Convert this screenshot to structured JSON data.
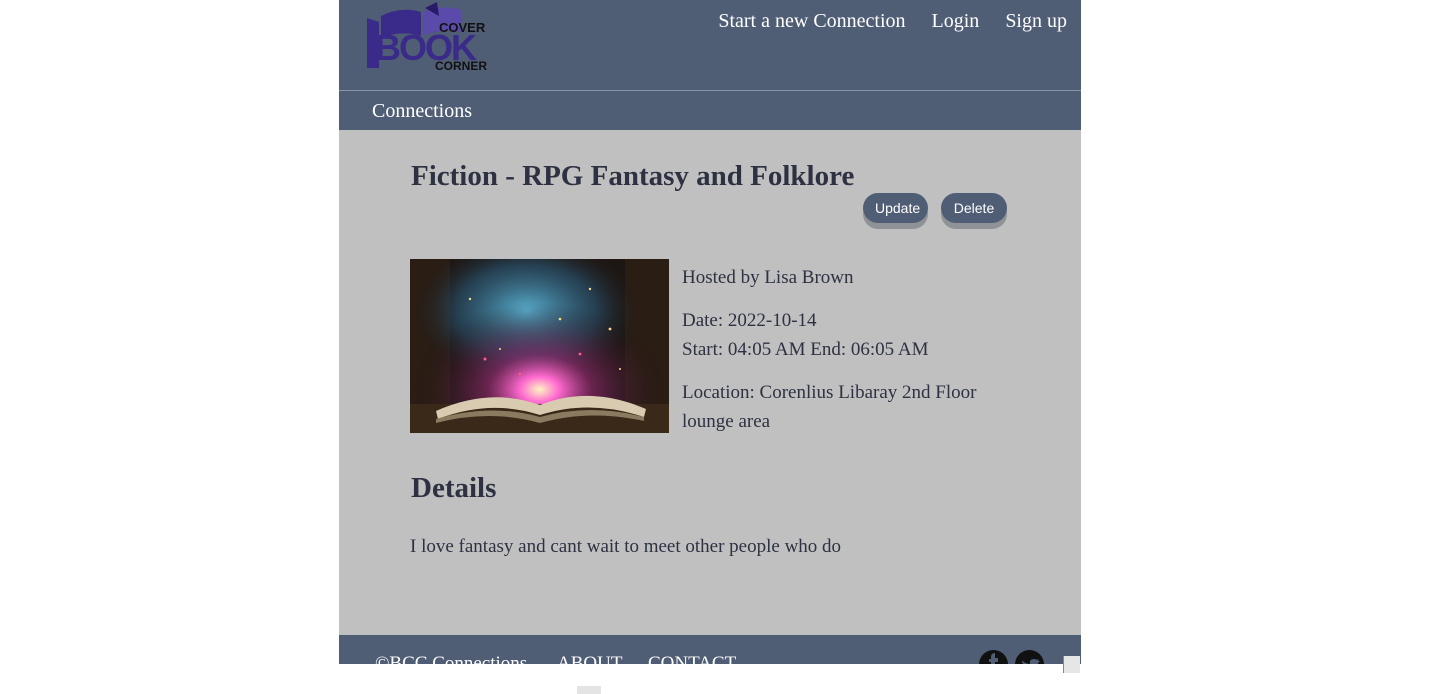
{
  "header": {
    "logo_text": {
      "top": "COVER",
      "main": "BOOK",
      "bottom": "CORNER"
    },
    "nav": [
      {
        "label": "Start a new Connection"
      },
      {
        "label": "Login"
      },
      {
        "label": "Sign up"
      }
    ]
  },
  "subnav": {
    "label": "Connections"
  },
  "connection": {
    "title": "Fiction - RPG Fantasy and Folklore",
    "update_label": "Update",
    "delete_label": "Delete",
    "host": "Hosted by Lisa Brown",
    "date": "Date: 2022-10-14",
    "time": "Start: 04:05 AM End: 06:05 AM",
    "location": "Location: Corenlius Libaray 2nd Floor lounge area",
    "details_heading": "Details",
    "details": "I love fantasy and cant wait to meet other people who do"
  },
  "footer": {
    "copyright": "©BCC Connections",
    "about": "ABOUT",
    "contact": "CONTACT",
    "icons": [
      "facebook-icon",
      "twitter-icon"
    ]
  },
  "colors": {
    "header_bg": "#4f5d75",
    "body_bg": "#bfc0bf",
    "text": "#2d3142",
    "logo": "#3a2a8a"
  }
}
